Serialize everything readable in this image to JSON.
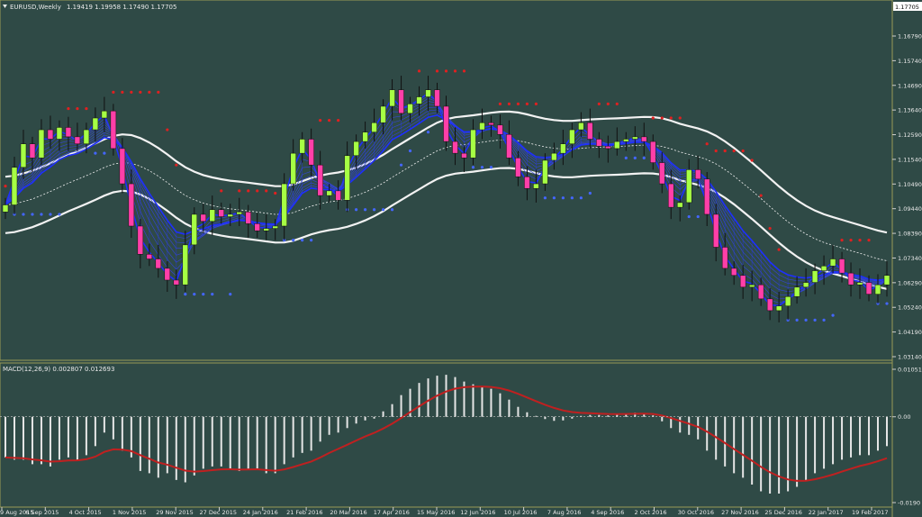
{
  "chart_data": [
    {
      "type": "candlestick",
      "title": "EURUSD,Weekly  1.19419 1.19958 1.17490 1.17705",
      "symbol_label": "EURUSD,Weekly",
      "ohlc_label": "1.19419 1.19958 1.17490 1.17705",
      "last_price_label": "1.17705",
      "y_ticks": [
        "1.16790",
        "1.15740",
        "1.14690",
        "1.13640",
        "1.12590",
        "1.11540",
        "1.10490",
        "1.09440",
        "1.08390",
        "1.07340",
        "1.06290",
        "1.05240",
        "1.04190",
        "1.03140"
      ],
      "ylim": [
        1.0314,
        1.1771
      ],
      "x_ticks": [
        "9 Aug 2015",
        "6 Sep 2015",
        "4 Oct 2015",
        "1 Nov 2015",
        "29 Nov 2015",
        "27 Dec 2015",
        "24 Jan 2016",
        "21 Feb 2016",
        "20 Mar 2016",
        "17 Apr 2016",
        "15 May 2016",
        "12 Jun 2016",
        "10 Jul 2016",
        "7 Aug 2016",
        "4 Sep 2016",
        "2 Oct 2016",
        "30 Oct 2016",
        "27 Nov 2016",
        "25 Dec 2016",
        "22 Jan 2017",
        "19 Feb 2017"
      ],
      "close": [
        1.096,
        1.112,
        1.122,
        1.116,
        1.128,
        1.124,
        1.129,
        1.125,
        1.122,
        1.128,
        1.133,
        1.136,
        1.12,
        1.105,
        1.087,
        1.075,
        1.073,
        1.069,
        1.064,
        1.062,
        1.079,
        1.092,
        1.089,
        1.094,
        1.091,
        1.092,
        1.093,
        1.088,
        1.085,
        1.086,
        1.087,
        1.105,
        1.118,
        1.124,
        1.113,
        1.1,
        1.102,
        1.098,
        1.117,
        1.123,
        1.127,
        1.131,
        1.138,
        1.145,
        1.135,
        1.139,
        1.142,
        1.145,
        1.138,
        1.123,
        1.118,
        1.116,
        1.128,
        1.131,
        1.13,
        1.126,
        1.116,
        1.108,
        1.103,
        1.105,
        1.115,
        1.118,
        1.122,
        1.128,
        1.131,
        1.124,
        1.121,
        1.12,
        1.123,
        1.124,
        1.125,
        1.123,
        1.114,
        1.105,
        1.095,
        1.097,
        1.111,
        1.107,
        1.092,
        1.078,
        1.069,
        1.066,
        1.061,
        1.062,
        1.056,
        1.051,
        1.053,
        1.057,
        1.061,
        1.063,
        1.068,
        1.07,
        1.073,
        1.067,
        1.062,
        1.063,
        1.058,
        1.062,
        1.066
      ],
      "ema_bands": [
        {
          "name": "upper band",
          "color": "#ffffff"
        },
        {
          "name": "middle band",
          "color": "#ffffff",
          "style": "dotted"
        },
        {
          "name": "lower band",
          "color": "#ffffff"
        }
      ],
      "parabolic_sar_color": "#e02020",
      "ribbon_color": "#2233ee"
    },
    {
      "type": "bar+line",
      "title": "MACD(12,26,9) 0.002807 0.012693",
      "label": "MACD(12,26,9) 0.002807 0.012693",
      "y_ticks": [
        "0.010518",
        "0.00",
        "-0.0190"
      ],
      "ylim": [
        -0.019,
        0.010518
      ],
      "histogram": [
        -0.009,
        -0.0095,
        -0.0095,
        -0.0105,
        -0.0105,
        -0.011,
        -0.0095,
        -0.009,
        -0.0095,
        -0.0085,
        -0.0065,
        -0.0035,
        -0.005,
        -0.0075,
        -0.009,
        -0.012,
        -0.0125,
        -0.0135,
        -0.0125,
        -0.014,
        -0.0145,
        -0.013,
        -0.0115,
        -0.011,
        -0.011,
        -0.0115,
        -0.012,
        -0.0115,
        -0.0115,
        -0.0125,
        -0.0125,
        -0.0105,
        -0.009,
        -0.008,
        -0.0075,
        -0.0055,
        -0.004,
        -0.0035,
        -0.0025,
        -0.0015,
        -0.0008,
        -0.0004,
        0.0012,
        0.0028,
        0.0048,
        0.0062,
        0.0075,
        0.0085,
        0.0091,
        0.0093,
        0.0088,
        0.0078,
        0.0072,
        0.0068,
        0.0062,
        0.0052,
        0.0038,
        0.0022,
        0.001,
        0.0002,
        -0.0005,
        -0.0009,
        -0.0008,
        -0.0004,
        0.0002,
        0.0004,
        0.0004,
        0.0003,
        0.0005,
        0.0007,
        0.0009,
        0.0008,
        0.0003,
        -0.001,
        -0.0025,
        -0.0035,
        -0.004,
        -0.005,
        -0.0075,
        -0.0095,
        -0.011,
        -0.0125,
        -0.0135,
        -0.015,
        -0.0165,
        -0.017,
        -0.017,
        -0.0165,
        -0.0155,
        -0.014,
        -0.0125,
        -0.0115,
        -0.0105,
        -0.0095,
        -0.009,
        -0.0085,
        -0.0085,
        -0.0075,
        -0.0065
      ],
      "signal_color": "#c02020",
      "histogram_color": "#e6e6e6"
    }
  ]
}
